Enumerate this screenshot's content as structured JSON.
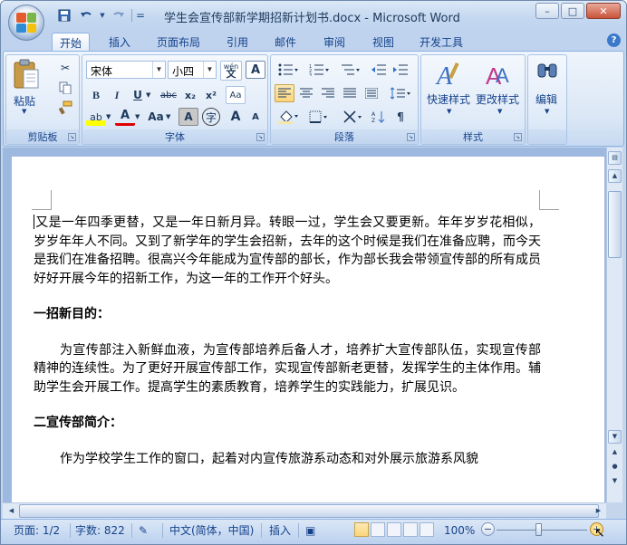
{
  "window": {
    "title": "学生会宣传部新学期招新计划书.docx - Microsoft Word",
    "controls": {
      "minimize": "–",
      "maximize": "□",
      "close": "✕"
    }
  },
  "quick_access": {
    "save_icon": "save-icon",
    "undo_icon": "undo-icon",
    "redo_icon": "redo-icon",
    "more": "="
  },
  "tabs": [
    "开始",
    "插入",
    "页面布局",
    "引用",
    "邮件",
    "审阅",
    "视图",
    "开发工具"
  ],
  "active_tab": "开始",
  "ribbon": {
    "clipboard": {
      "label": "剪贴板",
      "paste": "粘贴"
    },
    "font": {
      "label": "字体",
      "font_name": "宋体",
      "font_size": "小四",
      "wen": "wén\n文",
      "a_box": "A",
      "bold": "B",
      "italic": "I",
      "underline": "U",
      "strike": "abc",
      "sub": "x₂",
      "sup": "x²",
      "clear": "Aa",
      "highlight": "ab",
      "font_color": "A",
      "case": "Aa",
      "shade": "A",
      "circled": "字",
      "grow": "A",
      "shrink": "A"
    },
    "paragraph": {
      "label": "段落"
    },
    "styles": {
      "label": "样式",
      "quick_styles": "快速样式",
      "change_styles": "更改样式"
    },
    "editing": {
      "label": "编辑",
      "edit": "编辑"
    }
  },
  "document": {
    "para1": "又是一年四季更替，又是一年日新月异。转眼一过，学生会又要更新。年年岁岁花相似，岁岁年年人不同。又到了新学年的学生会招新，去年的这个时候是我们在准备应聘，而今天是我们在准备招聘。很高兴今年能成为宣传部的部长，作为部长我会带领宣传部的所有成员好好开展今年的招新工作，为这一年的工作开个好头。",
    "heading1": "一招新目的：",
    "para2": "为宣传部注入新鲜血液，为宣传部培养后备人才，培养扩大宣传部队伍，实现宣传部精神的连续性。为了更好开展宣传部工作，实现宣传部新老更替，发挥学生的主体作用。辅助学生会开展工作。提高学生的素质教育，培养学生的实践能力，扩展见识。",
    "heading2": "二宣传部简介：",
    "para3": "作为学校学生工作的窗口，起着对内宣传旅游系动态和对外展示旅游系风貌"
  },
  "status": {
    "page": "页面: 1/2",
    "words": "字数: 822",
    "language": "中文(简体，中国)",
    "insert": "插入",
    "zoom": "100%",
    "zoom_minus": "−",
    "zoom_plus": "+"
  }
}
